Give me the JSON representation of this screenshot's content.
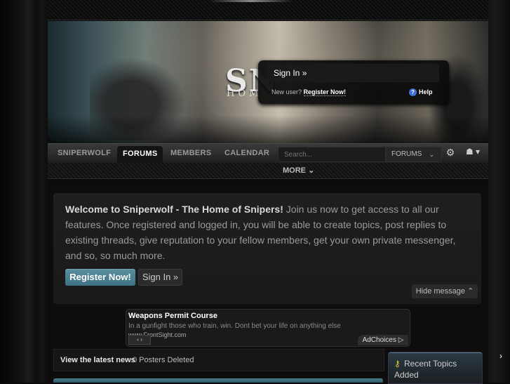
{
  "banner": {
    "title": "SN",
    "subtitle": "HOME"
  },
  "signin_popup": {
    "signin_label": "Sign In »",
    "new_user_prefix": "New user?",
    "register_label": "Register Now!",
    "help_label": "Help"
  },
  "nav": {
    "items": [
      "SNIPERWOLF",
      "FORUMS",
      "MEMBERS",
      "CALENDAR"
    ],
    "active": "FORUMS",
    "search_placeholder": "Search...",
    "search_scope": "FORUMS",
    "more_label": "MORE"
  },
  "welcome": {
    "heading": "Welcome to Sniperwolf - The Home of Snipers!",
    "body": " Join us now to get access to all our features. Once registered and logged in, you will be able to create topics, post replies to existing threads, give reputation to your fellow members, get your own private messenger, and so, so much more.",
    "register_button": "Register Now!",
    "signin_button": "Sign In »",
    "hide_label": "Hide message"
  },
  "ad": {
    "title": "Weapons Permit Course",
    "description": "In a gunfight those who train, win. Dont bet your life on anything else",
    "url": "www.FrontSight.com",
    "choices_label": "AdChoices"
  },
  "news": {
    "label": "View the latest news",
    "text": "0 Posters Deleted"
  },
  "recent": {
    "title": "Recent Topics Added"
  },
  "colors": {
    "accent": "#3e7284",
    "background": "#0d0d0d",
    "panel": "#1f1f1f"
  }
}
